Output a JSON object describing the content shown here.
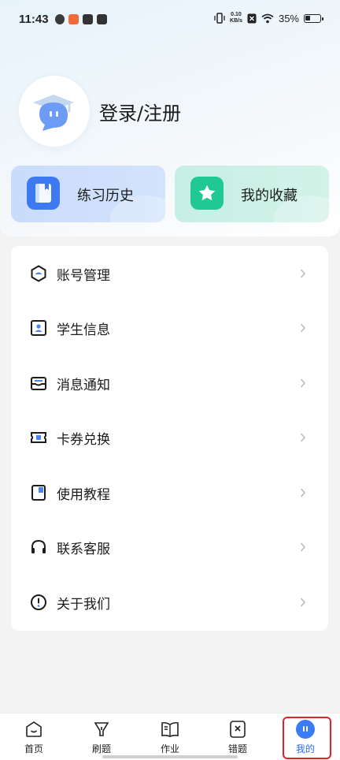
{
  "status_bar": {
    "time": "11:43",
    "net_speed_value": "0.10",
    "net_speed_unit": "KB/s",
    "battery": "35%"
  },
  "profile": {
    "login_label": "登录/注册"
  },
  "quick_actions": [
    {
      "label": "练习历史",
      "icon": "book-icon",
      "color": "#3d7af2"
    },
    {
      "label": "我的收藏",
      "icon": "star-icon",
      "color": "#21c992"
    }
  ],
  "menu": [
    {
      "label": "账号管理",
      "icon": "account-hexagon-icon"
    },
    {
      "label": "学生信息",
      "icon": "student-card-icon"
    },
    {
      "label": "消息通知",
      "icon": "message-tray-icon"
    },
    {
      "label": "卡券兑换",
      "icon": "coupon-ticket-icon"
    },
    {
      "label": "使用教程",
      "icon": "tutorial-book-icon"
    },
    {
      "label": "联系客服",
      "icon": "headset-icon"
    },
    {
      "label": "关于我们",
      "icon": "info-exclamation-icon"
    }
  ],
  "bottom_nav": [
    {
      "label": "首页",
      "icon": "home-icon"
    },
    {
      "label": "刷题",
      "icon": "practice-icon"
    },
    {
      "label": "作业",
      "icon": "homework-book-icon"
    },
    {
      "label": "错题",
      "icon": "wrong-answer-icon"
    },
    {
      "label": "我的",
      "icon": "profile-face-icon",
      "active": true
    }
  ],
  "colors": {
    "accent_blue": "#3b7cf5",
    "accent_green": "#21c992",
    "highlight": "#e02424"
  }
}
